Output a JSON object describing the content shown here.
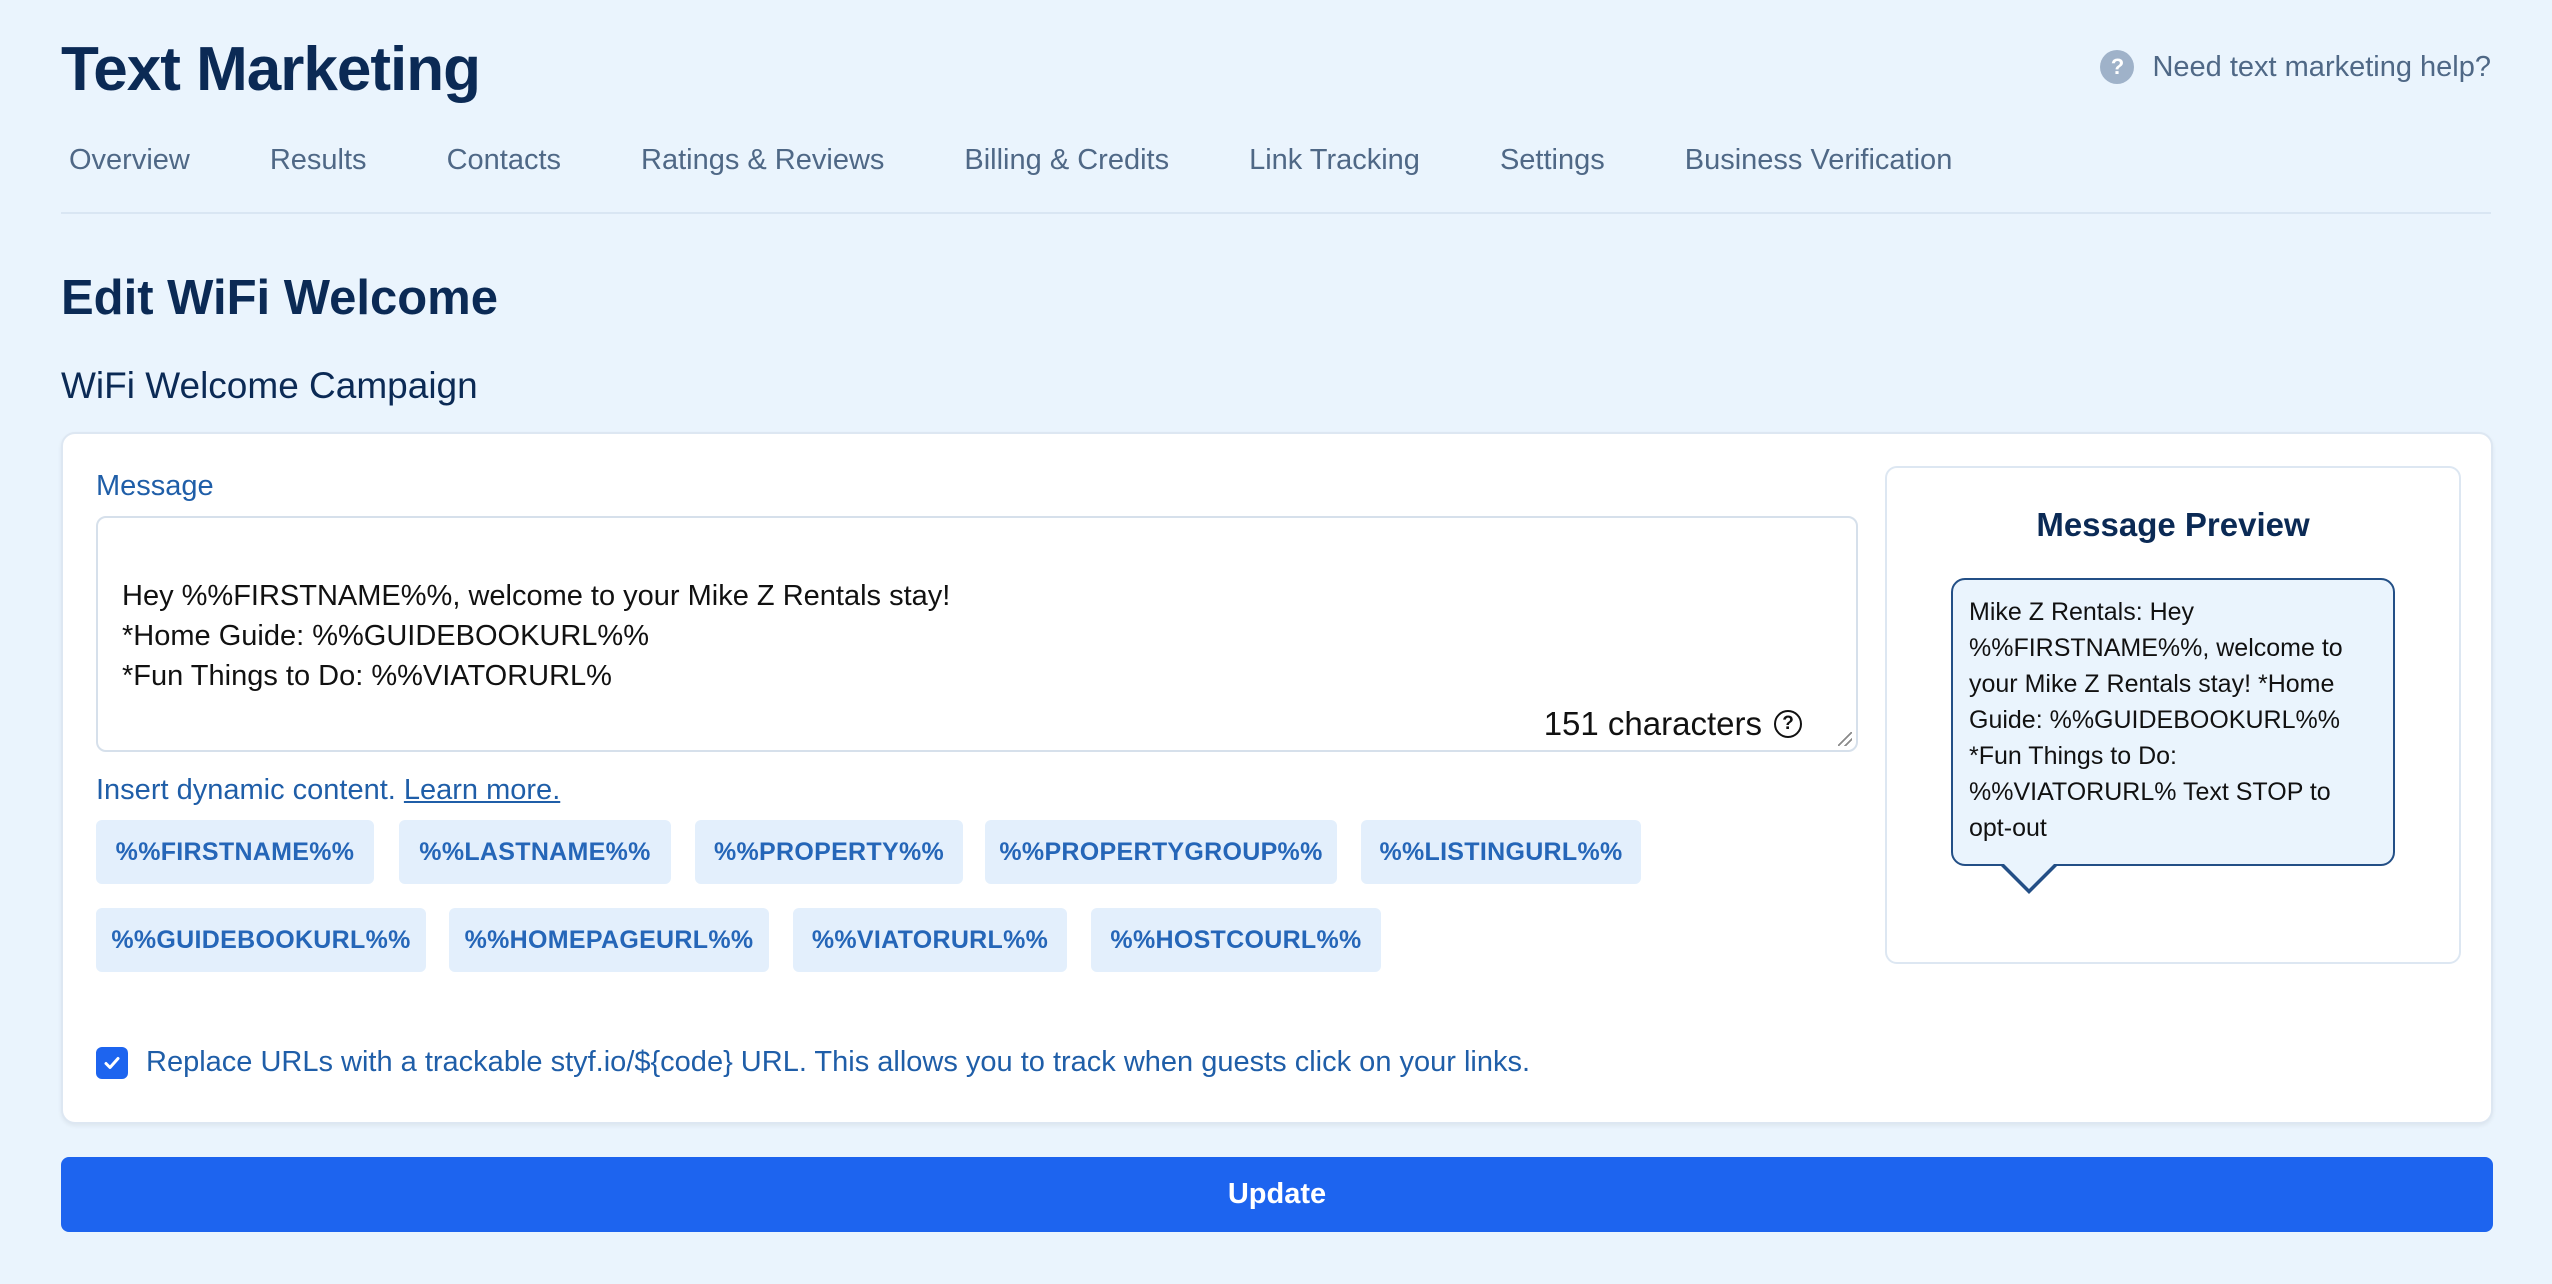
{
  "header": {
    "title": "Text Marketing",
    "help_label": "Need text marketing help?",
    "help_icon": "question-circle-icon"
  },
  "tabs": [
    {
      "label": "Overview"
    },
    {
      "label": "Results"
    },
    {
      "label": "Contacts"
    },
    {
      "label": "Ratings & Reviews"
    },
    {
      "label": "Billing & Credits"
    },
    {
      "label": "Link Tracking"
    },
    {
      "label": "Settings"
    },
    {
      "label": "Business Verification"
    }
  ],
  "page": {
    "title": "Edit WiFi Welcome",
    "section_title": "WiFi Welcome Campaign"
  },
  "message": {
    "label": "Message",
    "text": "Hey %%FIRSTNAME%%, welcome to your Mike Z Rentals stay!\n*Home Guide: %%GUIDEBOOKURL%%\n*Fun Things to Do: %%VIATORURL%",
    "char_count": "151 characters",
    "char_count_icon": "question-circle-icon"
  },
  "dynamic": {
    "intro": "Insert dynamic content.",
    "learn_more": "Learn more.",
    "chips": [
      "%%FIRSTNAME%%",
      "%%LASTNAME%%",
      "%%PROPERTY%%",
      "%%PROPERTYGROUP%%",
      "%%LISTINGURL%%",
      "%%GUIDEBOOKURL%%",
      "%%HOMEPAGEURL%%",
      "%%VIATORURL%%",
      "%%HOSTCOURL%%"
    ]
  },
  "tracking": {
    "checked": true,
    "label": "Replace URLs with a trackable styf.io/${code} URL. This allows you to track when guests click on your links."
  },
  "preview": {
    "title": "Message Preview",
    "bubble_text": "Mike Z Rentals: Hey %%FIRSTNAME%%, welcome to your Mike Z Rentals stay! *Home Guide: %%GUIDEBOOKURL%% *Fun Things to Do: %%VIATORURL% Text STOP to opt-out"
  },
  "actions": {
    "update_label": "Update"
  },
  "colors": {
    "background": "#eaf4fd",
    "primary": "#1d64ef",
    "heading": "#0b2a55",
    "muted": "#4f6886",
    "chip_bg": "#e3effc",
    "chip_text": "#2566b8"
  }
}
